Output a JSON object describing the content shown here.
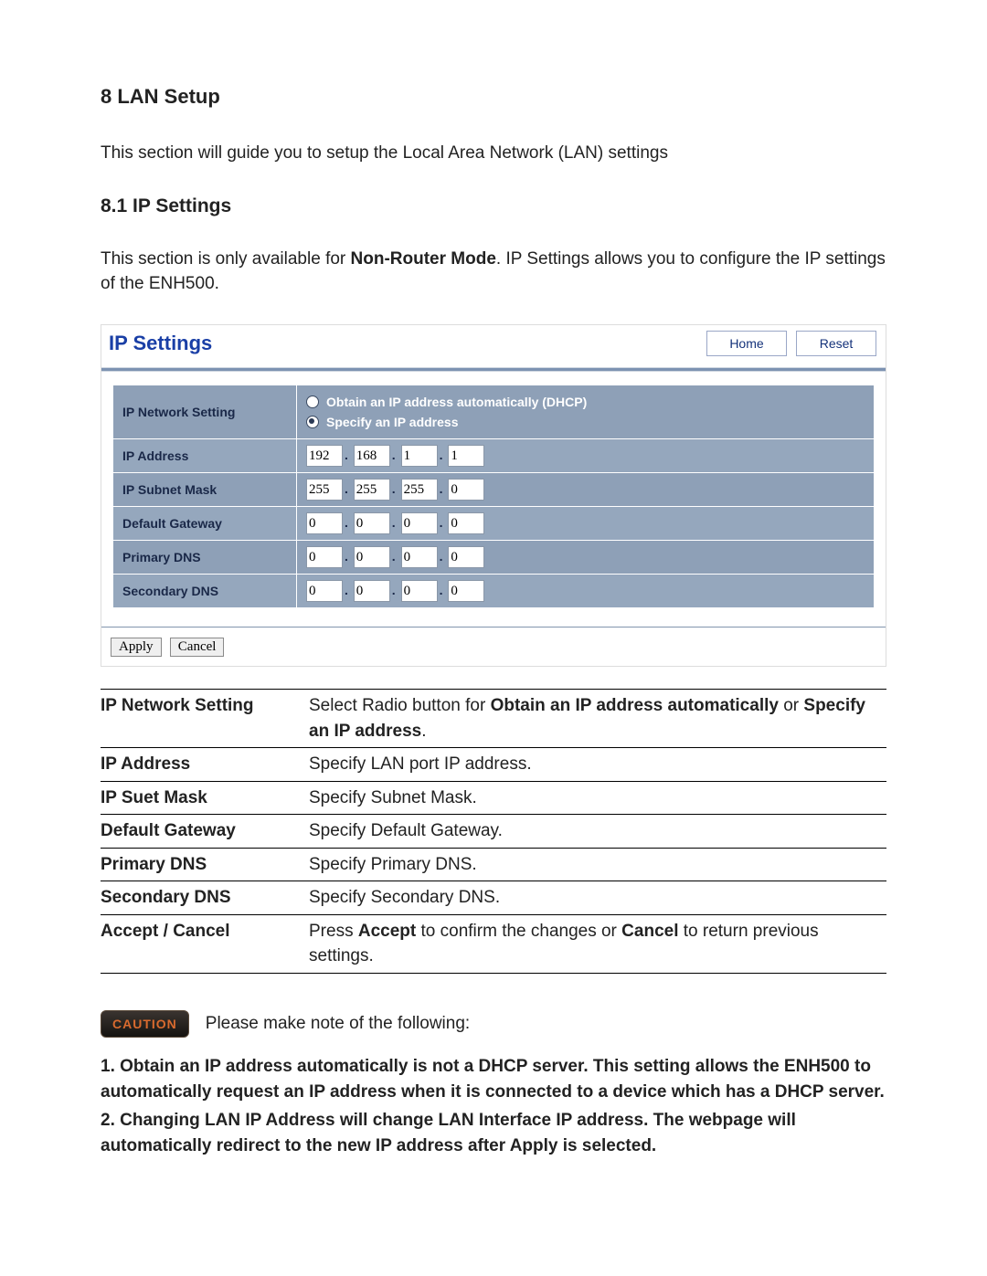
{
  "section": {
    "title": "8 LAN Setup",
    "intro": "This section will guide you to setup the Local Area Network (LAN) settings",
    "sub_title": "8.1 IP Settings",
    "sub_intro_pre": "This section is only available for ",
    "sub_intro_bold": "Non-Router Mode",
    "sub_intro_post": ". IP Settings allows you to configure the IP settings of the ENH500."
  },
  "panel": {
    "title": "IP Settings",
    "home": "Home",
    "reset": "Reset",
    "rows": {
      "ip_network_setting": "IP Network Setting",
      "ip_address": "IP Address",
      "ip_subnet_mask": "IP Subnet Mask",
      "default_gateway": "Default Gateway",
      "primary_dns": "Primary DNS",
      "secondary_dns": "Secondary DNS"
    },
    "radios": {
      "dhcp": "Obtain an IP address automatically (DHCP)",
      "specify": "Specify an IP address",
      "selected": "specify"
    },
    "ip_address": {
      "a": "192",
      "b": "168",
      "c": "1",
      "d": "1"
    },
    "ip_subnet_mask": {
      "a": "255",
      "b": "255",
      "c": "255",
      "d": "0"
    },
    "default_gateway": {
      "a": "0",
      "b": "0",
      "c": "0",
      "d": "0"
    },
    "primary_dns": {
      "a": "0",
      "b": "0",
      "c": "0",
      "d": "0"
    },
    "secondary_dns": {
      "a": "0",
      "b": "0",
      "c": "0",
      "d": "0"
    },
    "apply": "Apply",
    "cancel": "Cancel"
  },
  "desc": {
    "r1": {
      "k": "IP Network Setting",
      "pre": "Select Radio button for ",
      "b1": "Obtain an IP address automatically",
      "mid": " or ",
      "b2": "Specify an IP address",
      "post": "."
    },
    "r2": {
      "k": "IP Address",
      "v": "Specify LAN port IP address."
    },
    "r3": {
      "k": "IP Suet Mask",
      "v": "Specify Subnet Mask."
    },
    "r4": {
      "k": "Default Gateway",
      "v": "Specify Default Gateway."
    },
    "r5": {
      "k": "Primary DNS",
      "v": "Specify Primary DNS."
    },
    "r6": {
      "k": "Secondary DNS",
      "v": "Specify Secondary DNS."
    },
    "r7": {
      "k": "Accept / Cancel",
      "pre": "Press ",
      "b1": "Accept",
      "mid": " to confirm the changes or ",
      "b2": "Cancel",
      "post": " to return previous settings."
    }
  },
  "caution": {
    "badge": "CAUTION",
    "lead": "Please make note of the following:",
    "n1": "1. Obtain an IP address automatically is not a DHCP server. This setting allows the ENH500 to automatically request an IP address when it is connected to a device which has a DHCP server.",
    "n2": "2. Changing LAN IP Address will change LAN Interface IP address. The webpage will automatically redirect to the new IP address after Apply is selected."
  }
}
